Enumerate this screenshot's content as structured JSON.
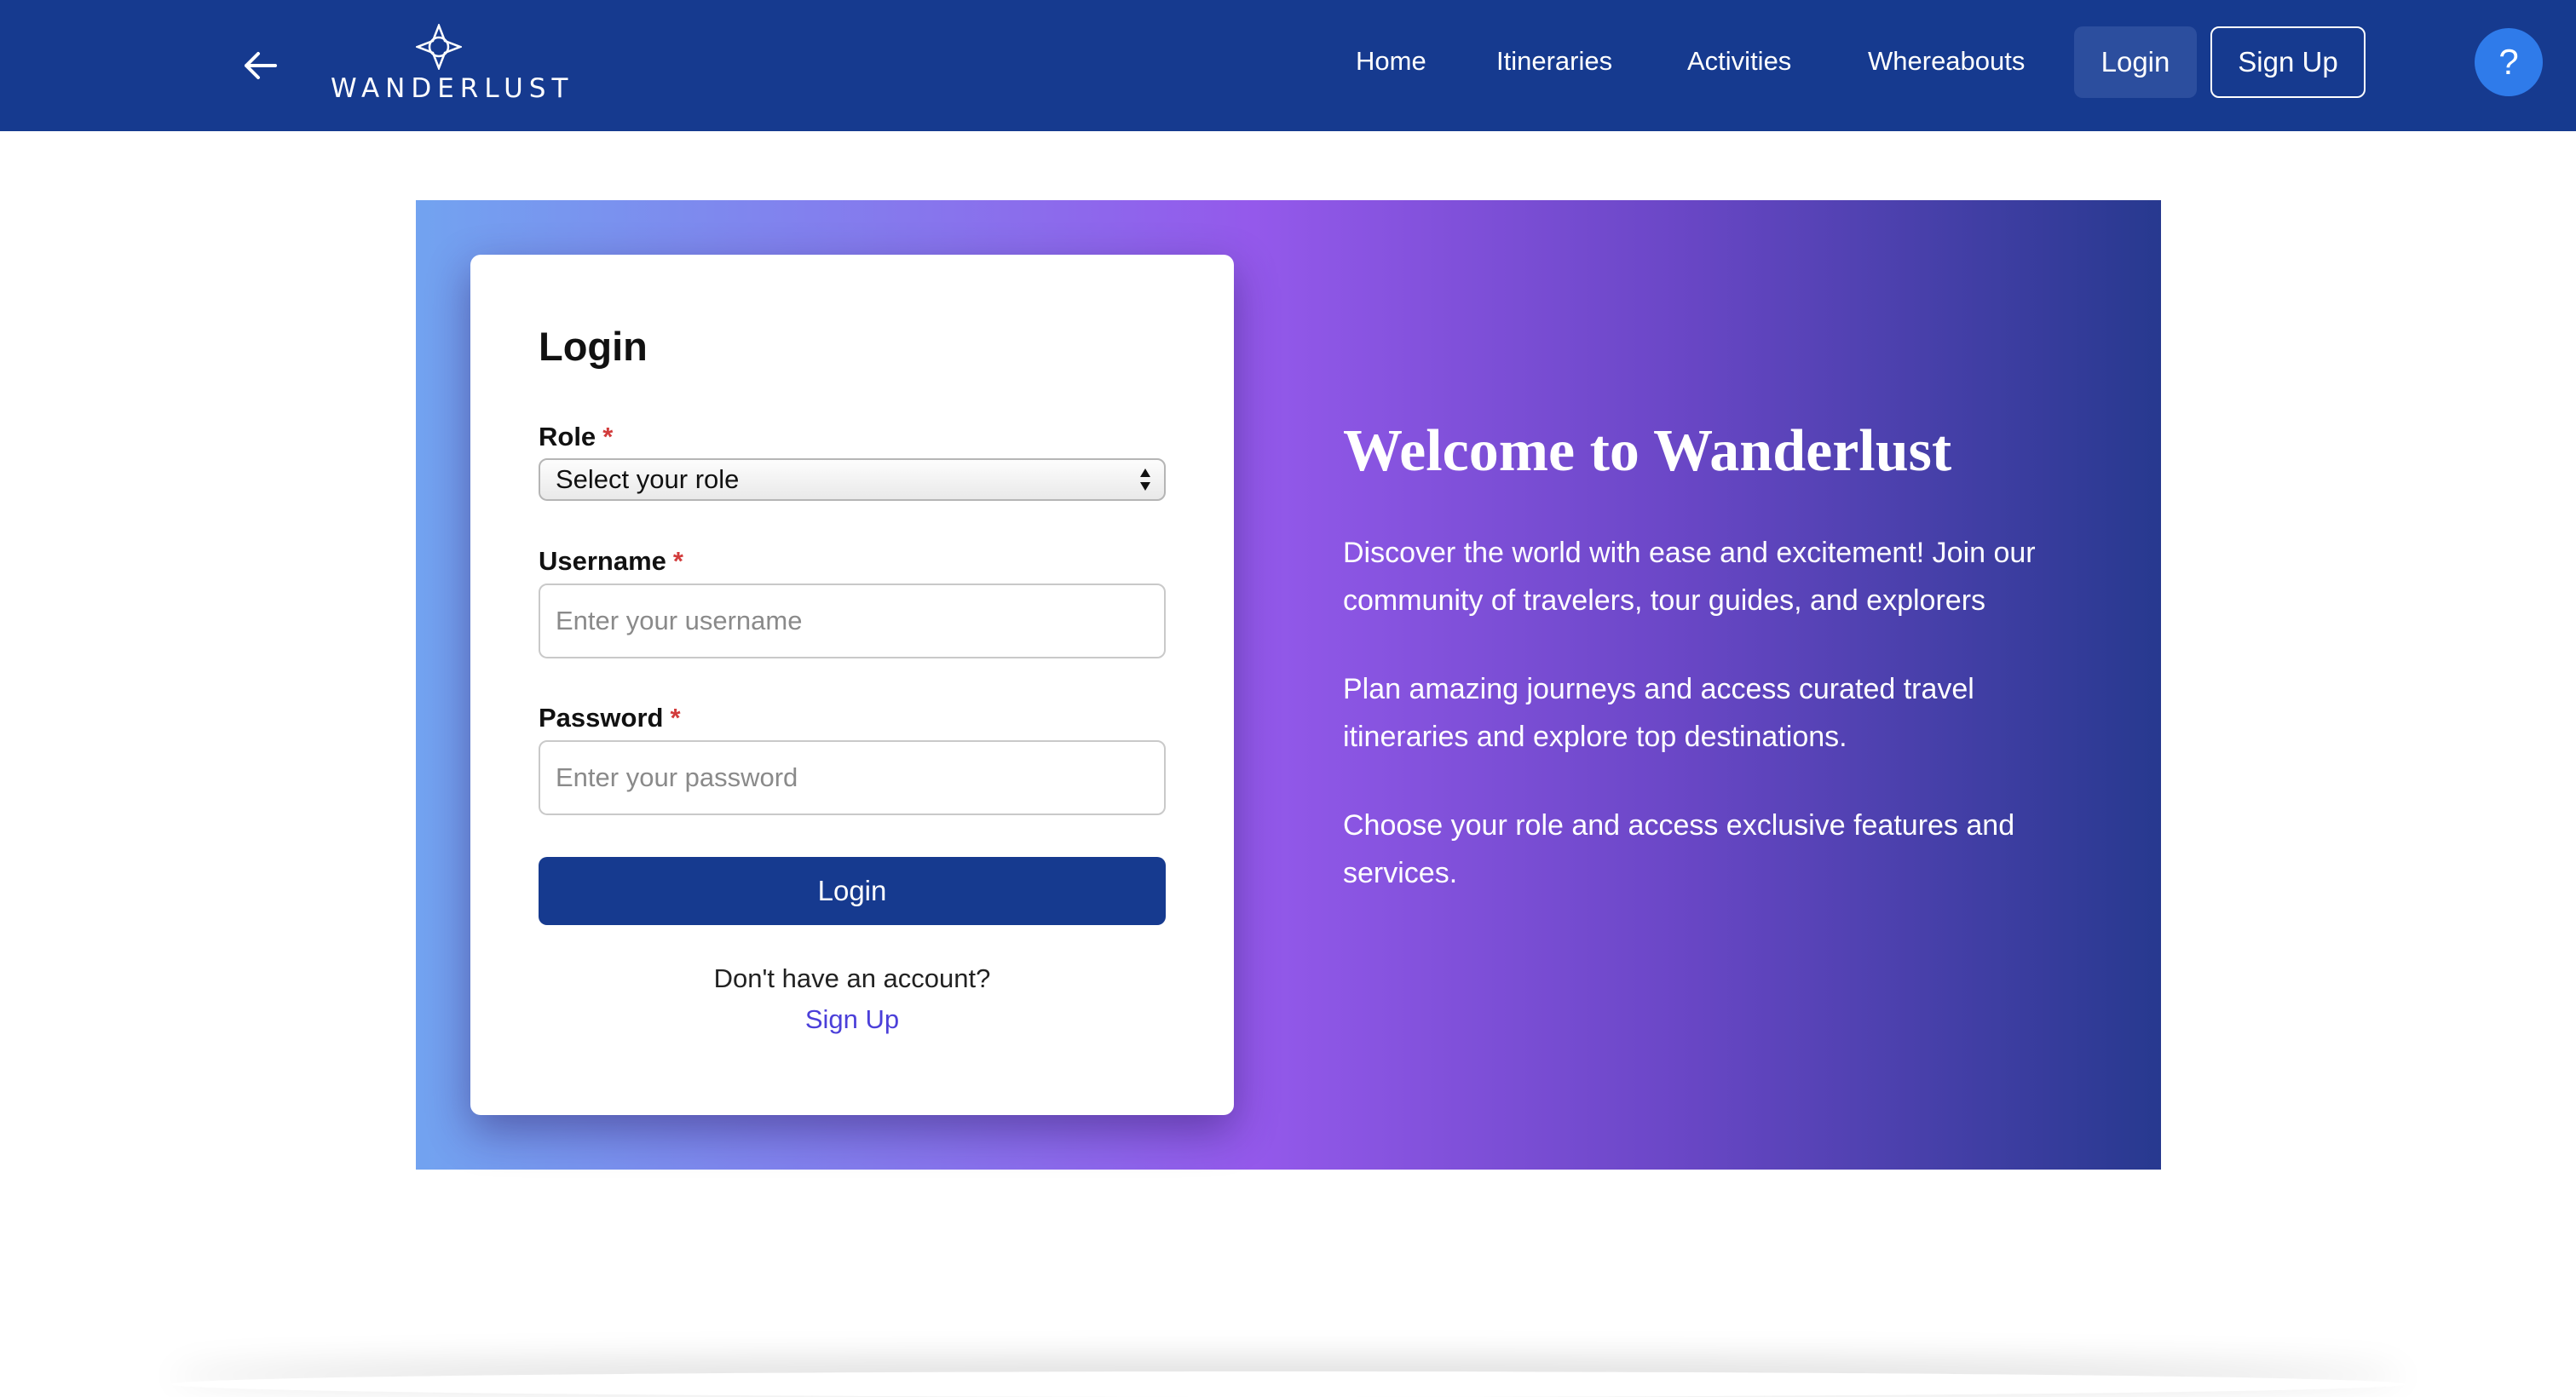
{
  "nav": {
    "brand": "WANDERLUST",
    "links": [
      "Home",
      "Itineraries",
      "Activities",
      "Whereabouts"
    ],
    "login_label": "Login",
    "signup_label": "Sign Up",
    "help_label": "?"
  },
  "login_form": {
    "title": "Login",
    "role_label": "Role",
    "role_selected": "Select your role",
    "username_label": "Username",
    "username_placeholder": "Enter your username",
    "password_label": "Password",
    "password_placeholder": "Enter your password",
    "required_mark": "*",
    "submit_label": "Login",
    "no_account_text": "Don't have an account?",
    "signup_link": "Sign Up"
  },
  "welcome": {
    "title": "Welcome to Wanderlust",
    "paragraphs": [
      "Discover the world with ease and excitement! Join our community of travelers, tour guides, and explorers",
      "Plan amazing journeys and access curated travel itineraries and explore top destinations.",
      "Choose your role and access exclusive features and services."
    ]
  },
  "colors": {
    "navbar": "#163a8f",
    "primary_button": "#163a8f",
    "help_button": "#2f7bea",
    "required": "#d23c3c",
    "link": "#4b3fd9"
  },
  "icons": {
    "back": "arrow-left-icon",
    "logo": "compass-diamond-icon",
    "select": "updown-arrows-icon"
  }
}
